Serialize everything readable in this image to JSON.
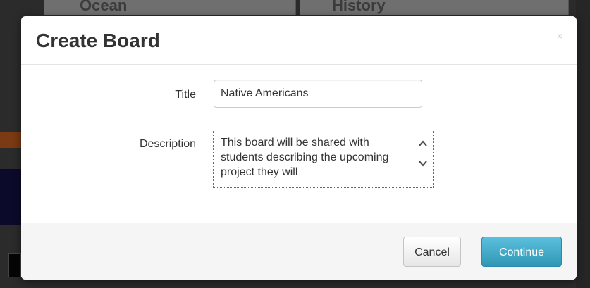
{
  "background": {
    "card_1_title": "Ocean",
    "card_2_title": "History"
  },
  "modal": {
    "title": "Create Board",
    "close_label": "×",
    "fields": {
      "title_label": "Title",
      "title_value": "Native Americans",
      "description_label": "Description",
      "description_value": "This board will be shared with students describing the upcoming project they will"
    },
    "buttons": {
      "cancel_label": "Cancel",
      "continue_label": "Continue"
    }
  },
  "colors": {
    "primary": "#49afcd",
    "backdrop": "#2b2b2b",
    "footer": "#f5f5f5"
  },
  "icons": {
    "close": "close-icon",
    "scroll_up": "chevron-up-icon",
    "scroll_down": "chevron-down-icon"
  }
}
